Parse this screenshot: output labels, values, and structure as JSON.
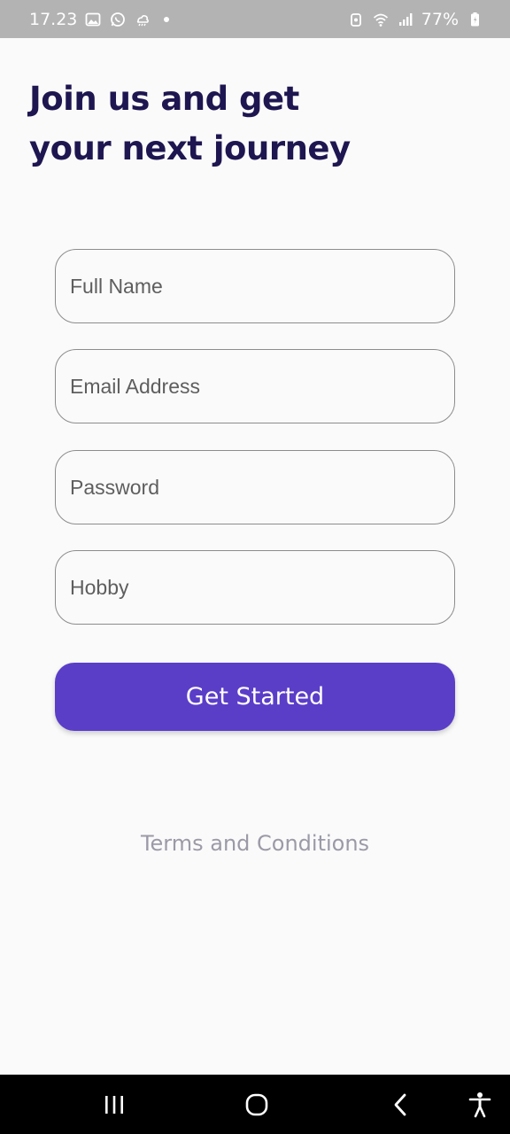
{
  "status_bar": {
    "time": "17.23",
    "battery": "77%",
    "left_icons": [
      "image-icon",
      "whatsapp-icon",
      "weather-icon",
      "dot-icon"
    ],
    "right_icons": [
      "alarm-icon",
      "wifi-icon",
      "signal-icon",
      "battery-icon"
    ]
  },
  "heading": {
    "line1": "Join us and get",
    "line2": "your next journey"
  },
  "form": {
    "full_name_placeholder": "Full Name",
    "email_placeholder": "Email Address",
    "password_placeholder": "Password",
    "hobby_placeholder": "Hobby",
    "submit_label": "Get Started"
  },
  "footer": {
    "terms_link": "Terms and Conditions"
  },
  "nav_bar": {
    "buttons": [
      "recent-apps-icon",
      "home-icon",
      "back-icon",
      "accessibility-icon"
    ]
  },
  "colors": {
    "status_bar_bg": "#b3b3b3",
    "heading": "#1e1650",
    "accent": "#5a3ec8",
    "terms": "#9b9aa7",
    "nav_bar_bg": "#000000"
  }
}
